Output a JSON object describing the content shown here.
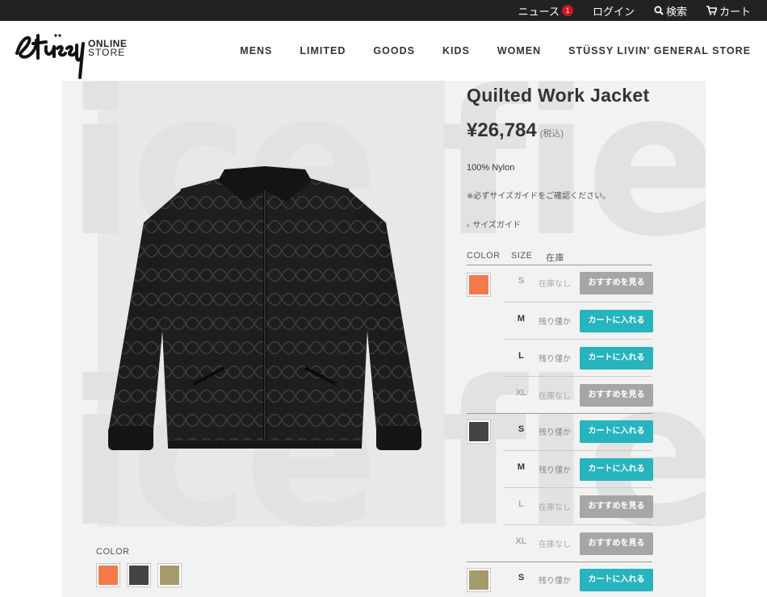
{
  "topbar": {
    "news": "ニュース",
    "news_badge": "1",
    "login": "ログイン",
    "search": "検索",
    "cart": "カート"
  },
  "header": {
    "brand_line1": "ONLINE",
    "brand_line2": "STORE",
    "nav": [
      "MENS",
      "LIMITED",
      "GOODS",
      "KIDS",
      "WOMEN",
      "STÜSSY LIVIN' GENERAL STORE"
    ]
  },
  "watermark": {
    "line1": "ice field",
    "line2": "ice field"
  },
  "product": {
    "title": "Quilted Work Jacket",
    "price": "¥26,784",
    "tax_note": "(税込)",
    "material": "100% Nylon",
    "notice": "※必ずサイズガイドをご確認ください。",
    "size_guide": "サイズガイド"
  },
  "gallery": {
    "color_label": "COLOR",
    "swatches": [
      {
        "name": "orange",
        "color": "#f37a4a"
      },
      {
        "name": "black",
        "color": "#444444"
      },
      {
        "name": "olive",
        "color": "#a59a6c"
      }
    ]
  },
  "table": {
    "headers": {
      "color": "COLOR",
      "size": "SIZE",
      "stock": "在庫"
    },
    "rows": [
      {
        "size": "S",
        "stock": "在庫なし",
        "action": "おすすめを見る"
      },
      {
        "size": "M",
        "stock": "残り僅か",
        "action": "カートに入れる"
      },
      {
        "size": "L",
        "stock": "残り僅か",
        "action": "カートに入れる"
      },
      {
        "size": "XL",
        "stock": "在庫なし",
        "action": "おすすめを見る"
      },
      {
        "size": "S",
        "stock": "残り僅か",
        "action": "カートに入れる"
      },
      {
        "size": "M",
        "stock": "残り僅か",
        "action": "カートに入れる"
      },
      {
        "size": "L",
        "stock": "在庫なし",
        "action": "おすすめを見る"
      },
      {
        "size": "XL",
        "stock": "在庫なし",
        "action": "おすすめを見る"
      },
      {
        "size": "S",
        "stock": "残り僅か",
        "action": "カートに入れる"
      }
    ]
  },
  "colors": {
    "cart_button": "#26b4be",
    "recommend_button": "#a6a6a6",
    "badge": "#d0161b"
  }
}
